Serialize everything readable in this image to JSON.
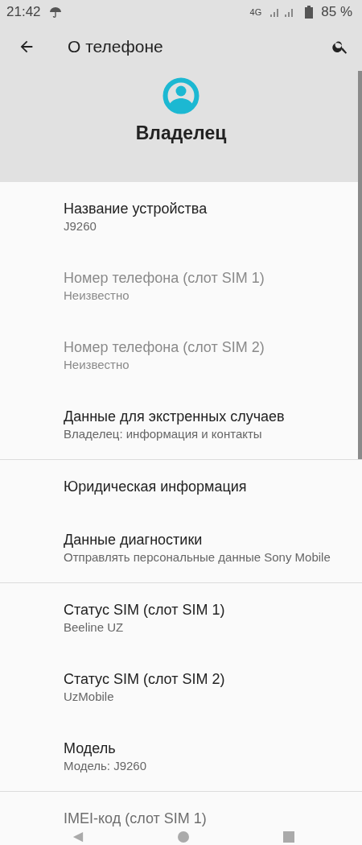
{
  "status_bar": {
    "time": "21:42",
    "network": "4G",
    "battery": "85 %"
  },
  "toolbar": {
    "title": "О телефоне"
  },
  "header": {
    "owner": "Владелец"
  },
  "sections": [
    {
      "items": [
        {
          "title": "Название устройства",
          "summary": "J9260",
          "disabled": false
        },
        {
          "title": "Номер телефона (слот SIM 1)",
          "summary": "Неизвестно",
          "disabled": true
        },
        {
          "title": "Номер телефона (слот SIM 2)",
          "summary": "Неизвестно",
          "disabled": true
        },
        {
          "title": "Данные для экстренных случаев",
          "summary": "Владелец: информация и контакты",
          "disabled": false
        }
      ]
    },
    {
      "items": [
        {
          "title": "Юридическая информация",
          "disabled": false
        },
        {
          "title": "Данные диагностики",
          "summary": "Отправлять персональные данные Sony Mobile",
          "disabled": false
        }
      ]
    },
    {
      "items": [
        {
          "title": "Статус SIM (слот SIM 1)",
          "summary": "Beeline UZ",
          "disabled": false
        },
        {
          "title": "Статус SIM (слот SIM 2)",
          "summary": "UzMobile",
          "disabled": false
        },
        {
          "title": "Модель",
          "summary": "Модель: J9260",
          "disabled": false
        }
      ]
    },
    {
      "items": [
        {
          "title": "IMEI-код (слот SIM 1)",
          "disabled": false
        }
      ]
    }
  ]
}
